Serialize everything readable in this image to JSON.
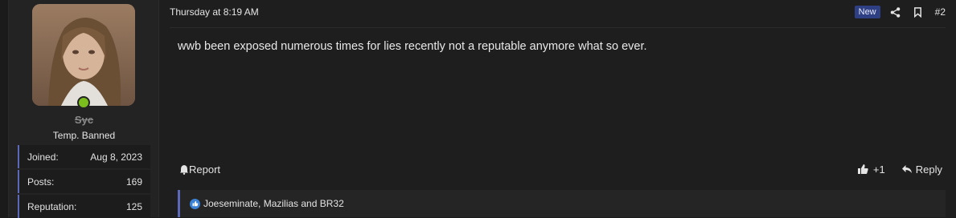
{
  "user": {
    "name": "Syc",
    "title": "Temp. Banned",
    "stats": [
      {
        "label": "Joined:",
        "value": "Aug 8, 2023"
      },
      {
        "label": "Posts:",
        "value": "169"
      },
      {
        "label": "Reputation:",
        "value": "125"
      }
    ]
  },
  "post": {
    "timestamp": "Thursday at 8:19 AM",
    "badge": "New",
    "number": "#2",
    "message": "wwb been exposed numerous times for lies recently not a reputable anymore what so ever.",
    "report_label": "Report",
    "like_count": "+1",
    "reply_label": "Reply",
    "reactions_text": "Joeseminate, Mazilias and BR32"
  },
  "colors": {
    "accent": "#5b69b8",
    "new_badge": "#2f3f84",
    "online": "#7bbd1d",
    "like": "#3b82d6"
  },
  "icons": [
    "share-icon",
    "bookmark-icon",
    "bell-icon",
    "thumbs-up-icon",
    "reply-arrow-icon"
  ]
}
